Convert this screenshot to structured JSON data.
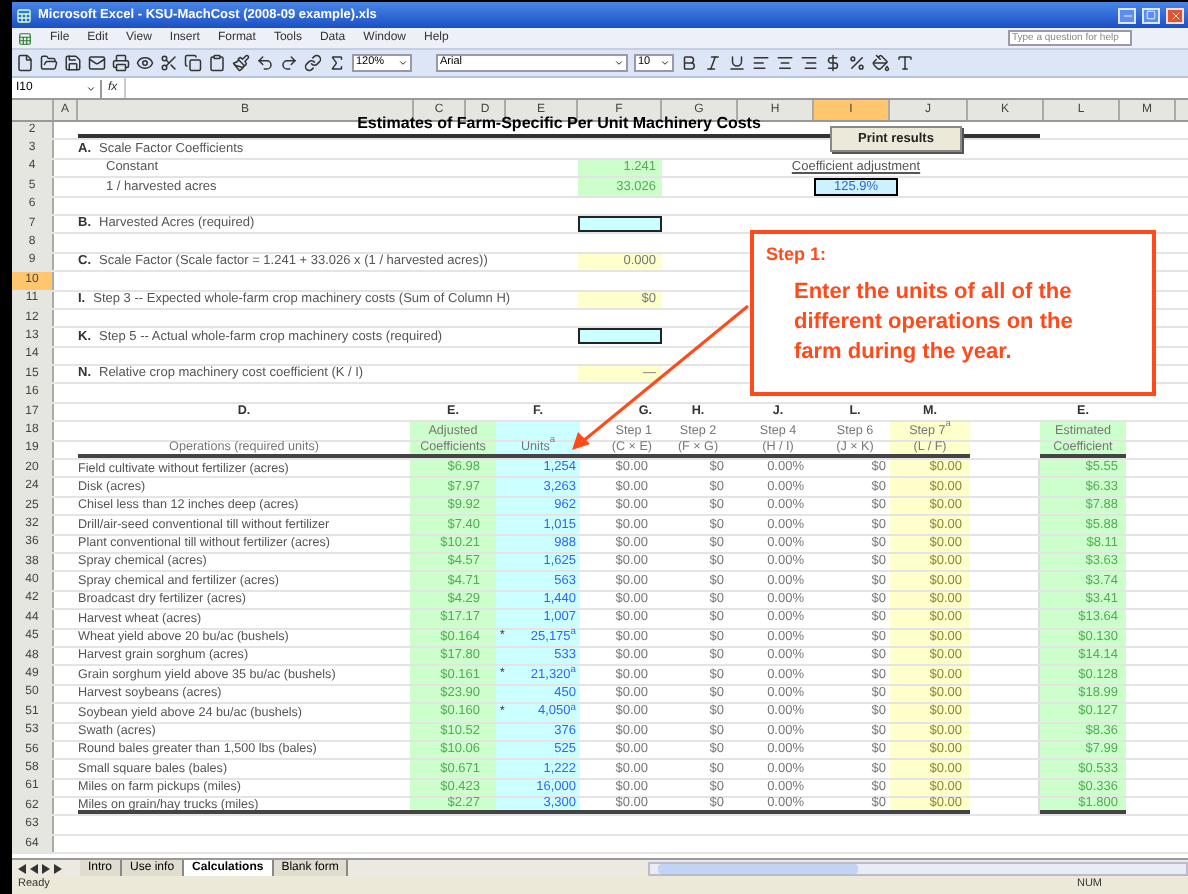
{
  "window": {
    "title": "Microsoft Excel - KSU-MachCost (2008-09 example).xls"
  },
  "menu": [
    "File",
    "Edit",
    "View",
    "Insert",
    "Format",
    "Tools",
    "Data",
    "Window",
    "Help"
  ],
  "help_field": {
    "placeholder": "Type a question for help"
  },
  "toolbar": {
    "zoom": "120%",
    "font": "Arial",
    "font_size": "10"
  },
  "formula_bar": {
    "name_box": "I10",
    "formula_label": "fx"
  },
  "column_headers": [
    {
      "label": "A",
      "selected": false
    },
    {
      "label": "B",
      "selected": false
    },
    {
      "label": "C",
      "selected": false
    },
    {
      "label": "D",
      "selected": false
    },
    {
      "label": "E",
      "selected": false
    },
    {
      "label": "F",
      "selected": false
    },
    {
      "label": "G",
      "selected": false
    },
    {
      "label": "H",
      "selected": false
    },
    {
      "label": "I",
      "selected": true
    },
    {
      "label": "J",
      "selected": false
    },
    {
      "label": "K",
      "selected": false
    },
    {
      "label": "L",
      "selected": false
    },
    {
      "label": "M",
      "selected": false
    }
  ],
  "row_headers": [
    {
      "label": "2",
      "selected": false
    },
    {
      "label": "3",
      "selected": false
    },
    {
      "label": "4",
      "selected": false
    },
    {
      "label": "5",
      "selected": false
    },
    {
      "label": "6",
      "selected": false
    },
    {
      "label": "7",
      "selected": false
    },
    {
      "label": "8",
      "selected": false
    },
    {
      "label": "9",
      "selected": false
    },
    {
      "label": "10",
      "selected": true
    },
    {
      "label": "11",
      "selected": false
    },
    {
      "label": "12",
      "selected": false
    },
    {
      "label": "13",
      "selected": false
    },
    {
      "label": "14",
      "selected": false
    },
    {
      "label": "15",
      "selected": false
    },
    {
      "label": "16",
      "selected": false
    },
    {
      "label": "17",
      "selected": false
    },
    {
      "label": "18",
      "selected": false
    },
    {
      "label": "19",
      "selected": false
    },
    {
      "label": "20",
      "selected": false
    },
    {
      "label": "24",
      "selected": false
    },
    {
      "label": "25",
      "selected": false
    },
    {
      "label": "32",
      "selected": false
    },
    {
      "label": "36",
      "selected": false
    },
    {
      "label": "38",
      "selected": false
    },
    {
      "label": "40",
      "selected": false
    },
    {
      "label": "42",
      "selected": false
    },
    {
      "label": "44",
      "selected": false
    },
    {
      "label": "45",
      "selected": false
    },
    {
      "label": "48",
      "selected": false
    },
    {
      "label": "49",
      "selected": false
    },
    {
      "label": "50",
      "selected": false
    },
    {
      "label": "51",
      "selected": false
    },
    {
      "label": "53",
      "selected": false
    },
    {
      "label": "56",
      "selected": false
    },
    {
      "label": "58",
      "selected": false
    },
    {
      "label": "61",
      "selected": false
    },
    {
      "label": "62",
      "selected": false
    },
    {
      "label": "63",
      "selected": false
    },
    {
      "label": "64",
      "selected": false
    }
  ],
  "sheet": {
    "title": "Estimates of Farm-Specific Per Unit Machinery Costs",
    "print_button": "Print results",
    "coefficients": {
      "letter": "A.",
      "heading": "Scale Factor Coefficients",
      "items": [
        {
          "label": "Constant",
          "value": "1.241"
        },
        {
          "label": "1 / harvested acres",
          "value": "33.026"
        }
      ]
    },
    "coefficient_adjustment": {
      "label": "Coefficient adjustment",
      "value": "125.9%"
    },
    "fields": [
      {
        "kind": "input",
        "letter": "B.",
        "label": "Harvested Acres (required)"
      },
      {
        "kind": "result",
        "letter": "C.",
        "label": "Scale Factor  (Scale factor = 1.241 + 33.026 x (1 / harvested acres))",
        "value": "0.000"
      },
      {
        "kind": "result",
        "letter": "I.",
        "label": "Step 3 -- Expected whole-farm crop machinery costs (Sum of Column H)",
        "value": "$0"
      },
      {
        "kind": "input",
        "letter": "K.",
        "label": "Step 5 -- Actual whole-farm crop machinery costs (required)"
      },
      {
        "kind": "result",
        "letter": "N.",
        "label": "Relative crop machinery cost coefficient (K / I)",
        "value": "—"
      }
    ]
  },
  "callout": {
    "heading": "Step 1:",
    "text": "Enter the units of all of the different operations on the farm during the year."
  },
  "table": {
    "columns": [
      {
        "letter": "D.",
        "caption": [
          "Operations (required units)"
        ]
      },
      {
        "letter": "E.",
        "caption": [
          "Adjusted",
          "Coefficients"
        ]
      },
      {
        "letter": "F.",
        "caption": [
          "Units$^{a}$"
        ]
      },
      {
        "letter": "G.",
        "caption": [
          "Step 1",
          "(C × E)"
        ]
      },
      {
        "letter": "H.",
        "caption": [
          "Step 2",
          "(F × G)"
        ]
      },
      {
        "letter": "J.",
        "caption": [
          "Step 4",
          "(H / I)"
        ]
      },
      {
        "letter": "L.",
        "caption": [
          "Step 6",
          "(J × K)"
        ]
      },
      {
        "letter": "M.",
        "caption": [
          "Step 7$^{a}$",
          "(L / F)"
        ]
      },
      {
        "letter": "E.",
        "caption": [
          "Estimated",
          "Coefficient"
        ]
      }
    ],
    "rows": [
      {
        "operation": "Field cultivate without fertilizer (acres)",
        "coefficient": "$6.98",
        "units": "1,254",
        "step1": "$0.00",
        "step2": "$0",
        "step4": "0.00%",
        "step6": "$0",
        "step7": "$0.00",
        "estimated": "$5.55"
      },
      {
        "operation": "Disk (acres)",
        "coefficient": "$7.97",
        "units": "3,263",
        "step1": "$0.00",
        "step2": "$0",
        "step4": "0.00%",
        "step6": "$0",
        "step7": "$0.00",
        "estimated": "$6.33"
      },
      {
        "operation": "Chisel less than 12 inches deep (acres)",
        "coefficient": "$9.92",
        "units": "962",
        "step1": "$0.00",
        "step2": "$0",
        "step4": "0.00%",
        "step6": "$0",
        "step7": "$0.00",
        "estimated": "$7.88"
      },
      {
        "operation": "Drill/air-seed conventional till without fertilizer",
        "coefficient": "$7.40",
        "units": "1,015",
        "step1": "$0.00",
        "step2": "$0",
        "step4": "0.00%",
        "step6": "$0",
        "step7": "$0.00",
        "estimated": "$5.88"
      },
      {
        "operation": "Plant conventional till without fertilizer (acres)",
        "coefficient": "$10.21",
        "units": "988",
        "step1": "$0.00",
        "step2": "$0",
        "step4": "0.00%",
        "step6": "$0",
        "step7": "$0.00",
        "estimated": "$8.11"
      },
      {
        "operation": "Spray chemical (acres)",
        "coefficient": "$4.57",
        "units": "1,625",
        "step1": "$0.00",
        "step2": "$0",
        "step4": "0.00%",
        "step6": "$0",
        "step7": "$0.00",
        "estimated": "$3.63"
      },
      {
        "operation": "Spray chemical and fertilizer (acres)",
        "coefficient": "$4.71",
        "units": "563",
        "step1": "$0.00",
        "step2": "$0",
        "step4": "0.00%",
        "step6": "$0",
        "step7": "$0.00",
        "estimated": "$3.74"
      },
      {
        "operation": "Broadcast dry fertilizer (acres)",
        "coefficient": "$4.29",
        "units": "1,440",
        "step1": "$0.00",
        "step2": "$0",
        "step4": "0.00%",
        "step6": "$0",
        "step7": "$0.00",
        "estimated": "$3.41"
      },
      {
        "operation": "Harvest wheat (acres)",
        "coefficient": "$17.17",
        "units": "1,007",
        "step1": "$0.00",
        "step2": "$0",
        "step4": "0.00%",
        "step6": "$0",
        "step7": "$0.00",
        "estimated": "$13.64"
      },
      {
        "operation": "Wheat yield above 20 bu/ac (bushels)",
        "coefficient": "$0.164",
        "flag": "*",
        "units": "25,175$^{a}$",
        "step1": "$0.00",
        "step2": "$0",
        "step4": "0.00%",
        "step6": "$0",
        "step7": "$0.00",
        "estimated": "$0.130"
      },
      {
        "operation": "Harvest grain sorghum (acres)",
        "coefficient": "$17.80",
        "units": "533",
        "step1": "$0.00",
        "step2": "$0",
        "step4": "0.00%",
        "step6": "$0",
        "step7": "$0.00",
        "estimated": "$14.14"
      },
      {
        "operation": "Grain sorghum yield above 35 bu/ac (bushels)",
        "coefficient": "$0.161",
        "flag": "*",
        "units": "21,320$^{a}$",
        "step1": "$0.00",
        "step2": "$0",
        "step4": "0.00%",
        "step6": "$0",
        "step7": "$0.00",
        "estimated": "$0.128"
      },
      {
        "operation": "Harvest soybeans (acres)",
        "coefficient": "$23.90",
        "units": "450",
        "step1": "$0.00",
        "step2": "$0",
        "step4": "0.00%",
        "step6": "$0",
        "step7": "$0.00",
        "estimated": "$18.99"
      },
      {
        "operation": "Soybean yield above 24 bu/ac (bushels)",
        "coefficient": "$0.160",
        "flag": "*",
        "units": "4,050$^{a}$",
        "step1": "$0.00",
        "step2": "$0",
        "step4": "0.00%",
        "step6": "$0",
        "step7": "$0.00",
        "estimated": "$0.127"
      },
      {
        "operation": "Swath (acres)",
        "coefficient": "$10.52",
        "units": "376",
        "step1": "$0.00",
        "step2": "$0",
        "step4": "0.00%",
        "step6": "$0",
        "step7": "$0.00",
        "estimated": "$8.36"
      },
      {
        "operation": "Round bales greater than 1,500 lbs (bales)",
        "coefficient": "$10.06",
        "units": "525",
        "step1": "$0.00",
        "step2": "$0",
        "step4": "0.00%",
        "step6": "$0",
        "step7": "$0.00",
        "estimated": "$7.99"
      },
      {
        "operation": "Small square bales (bales)",
        "coefficient": "$0.671",
        "units": "1,222",
        "step1": "$0.00",
        "step2": "$0",
        "step4": "0.00%",
        "step6": "$0",
        "step7": "$0.00",
        "estimated": "$0.533"
      },
      {
        "operation": "Miles on farm pickups (miles)",
        "coefficient": "$0.423",
        "units": "16,000",
        "step1": "$0.00",
        "step2": "$0",
        "step4": "0.00%",
        "step6": "$0",
        "step7": "$0.00",
        "estimated": "$0.336"
      },
      {
        "operation": "Miles on grain/hay trucks (miles)",
        "coefficient": "$2.27",
        "units": "3,300",
        "step1": "$0.00",
        "step2": "$0",
        "step4": "0.00%",
        "step6": "$0",
        "step7": "$0.00",
        "estimated": "$1.800"
      }
    ]
  },
  "sheet_tabs": [
    {
      "label": "Intro",
      "selected": false
    },
    {
      "label": "Use info",
      "selected": false
    },
    {
      "label": "Calculations",
      "selected": true
    },
    {
      "label": "Blank form",
      "selected": false
    }
  ],
  "status_bar": {
    "left": "Ready",
    "right": "NUM"
  }
}
